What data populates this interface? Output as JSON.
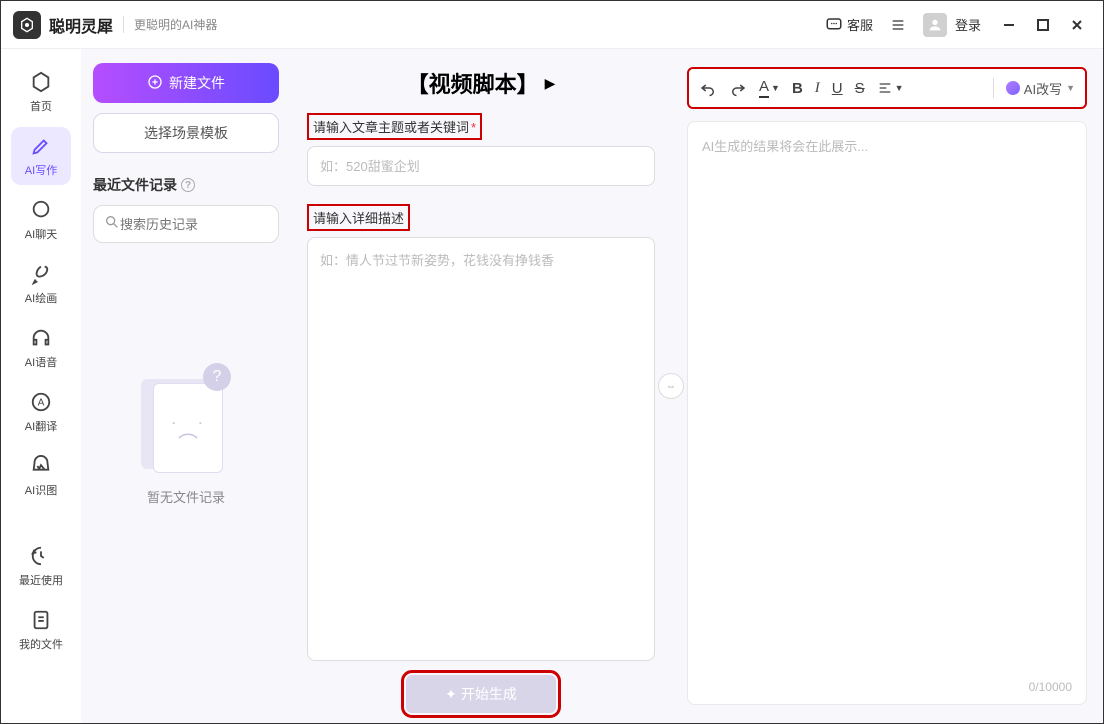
{
  "titlebar": {
    "app_name": "聪明灵犀",
    "app_subtitle": "更聪明的AI神器",
    "customer_service": "客服",
    "login": "登录"
  },
  "nav": {
    "items": [
      {
        "label": "首页",
        "icon": "home"
      },
      {
        "label": "AI写作",
        "icon": "pen",
        "active": true
      },
      {
        "label": "AI聊天",
        "icon": "chat"
      },
      {
        "label": "AI绘画",
        "icon": "brush"
      },
      {
        "label": "AI语音",
        "icon": "headphones"
      },
      {
        "label": "AI翻译",
        "icon": "translate"
      },
      {
        "label": "AI识图",
        "icon": "image"
      }
    ],
    "bottom": [
      {
        "label": "最近使用",
        "icon": "clock"
      },
      {
        "label": "我的文件",
        "icon": "file"
      }
    ]
  },
  "left_panel": {
    "new_file": "新建文件",
    "scene_template": "选择场景模板",
    "recent_files": "最近文件记录",
    "search_placeholder": "搜索历史记录",
    "empty_text": "暂无文件记录"
  },
  "center": {
    "title": "【视频脚本】",
    "label_topic": "请输入文章主题或者关键词",
    "topic_placeholder": "如：520甜蜜企划",
    "label_desc": "请输入详细描述",
    "desc_placeholder": "如：情人节过节新姿势，花钱没有挣钱香",
    "generate": "开始生成"
  },
  "right": {
    "rewrite": "AI改写",
    "output_placeholder": "AI生成的结果将会在此展示...",
    "counter": "0/10000"
  }
}
